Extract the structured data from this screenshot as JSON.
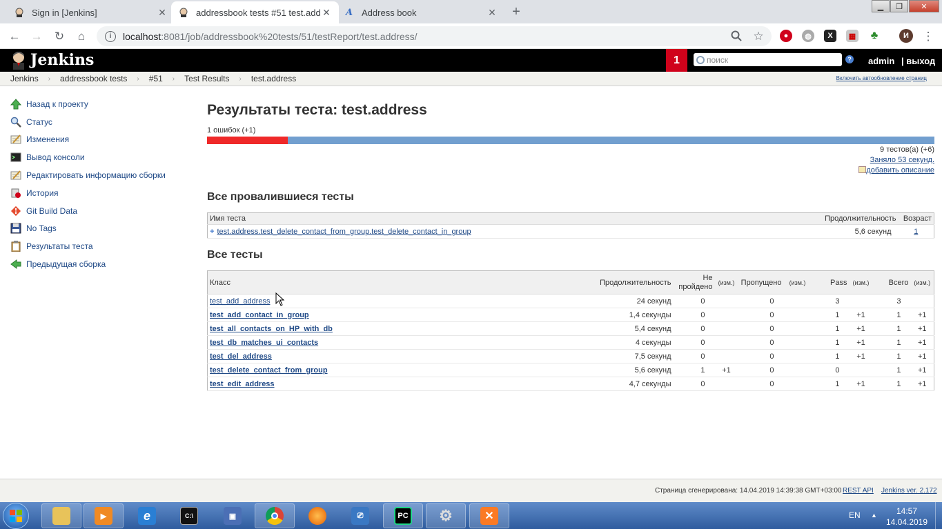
{
  "browser": {
    "tabs": [
      {
        "title": "Sign in [Jenkins]",
        "active": false
      },
      {
        "title": "addressbook tests #51 test.address",
        "active": true
      },
      {
        "title": "Address book",
        "active": false
      }
    ],
    "url_host": "localhost",
    "url_path": ":8081/job/addressbook%20tests/51/testReport/test.address/"
  },
  "header": {
    "logo_text": "Jenkins",
    "notification_count": "1",
    "search_placeholder": "поиск",
    "help": "?",
    "user": "admin",
    "logout": "| выход"
  },
  "breadcrumbs": [
    "Jenkins",
    "addressbook tests",
    "#51",
    "Test Results",
    "test.address"
  ],
  "auto_refresh": "Включить автообновление страниц",
  "sidebar": {
    "items": [
      {
        "label": "Назад к проекту",
        "icon": "up-arrow-icon"
      },
      {
        "label": "Статус",
        "icon": "magnifier-icon"
      },
      {
        "label": "Изменения",
        "icon": "notepad-icon"
      },
      {
        "label": "Вывод консоли",
        "icon": "terminal-icon"
      },
      {
        "label": "Редактировать информацию сборки",
        "icon": "notepad-icon"
      },
      {
        "label": "История",
        "icon": "history-icon"
      },
      {
        "label": "Git Build Data",
        "icon": "git-icon"
      },
      {
        "label": "No Tags",
        "icon": "floppy-icon"
      },
      {
        "label": "Результаты теста",
        "icon": "clipboard-icon"
      },
      {
        "label": "Предыдущая сборка",
        "icon": "left-arrow-icon"
      }
    ]
  },
  "main": {
    "title": "Результаты теста: test.address",
    "fail_summary": "1 ошибок (+1)",
    "fail_ratio": 0.111,
    "tests_count": "9 тестов(а) (+6)",
    "duration": "Заняло 53 секунд.",
    "add_description": "добавить описание",
    "failed_section": {
      "title": "Все провалившиеся тесты",
      "headers": [
        "Имя теста",
        "Продолжительность",
        "Возраст"
      ],
      "rows": [
        {
          "name": "test.address.test_delete_contact_from_group.test_delete_contact_in_group",
          "duration": "5,6 секунд",
          "age": "1"
        }
      ]
    },
    "all_section": {
      "title": "Все тесты",
      "headers": {
        "class": "Класс",
        "duration": "Продолжительность",
        "failed_1": "Не",
        "failed_2": "пройдено",
        "diff": "(изм.)",
        "skipped": "Пропущено",
        "pass": "Pass",
        "total": "Всего"
      },
      "rows": [
        {
          "name": "test_add_address",
          "bold": false,
          "duration": "24 секунд",
          "fail": "0",
          "fail_diff": "",
          "skip": "0",
          "skip_diff": "",
          "pass": "3",
          "pass_diff": "",
          "total": "3",
          "total_diff": ""
        },
        {
          "name": "test_add_contact_in_group",
          "bold": true,
          "duration": "1,4 секунды",
          "fail": "0",
          "fail_diff": "",
          "skip": "0",
          "skip_diff": "",
          "pass": "1",
          "pass_diff": "+1",
          "total": "1",
          "total_diff": "+1"
        },
        {
          "name": "test_all_contacts_on_HP_with_db",
          "bold": true,
          "duration": "5,4 секунд",
          "fail": "0",
          "fail_diff": "",
          "skip": "0",
          "skip_diff": "",
          "pass": "1",
          "pass_diff": "+1",
          "total": "1",
          "total_diff": "+1"
        },
        {
          "name": "test_db_matches_ui_contacts",
          "bold": true,
          "duration": "4 секунды",
          "fail": "0",
          "fail_diff": "",
          "skip": "0",
          "skip_diff": "",
          "pass": "1",
          "pass_diff": "+1",
          "total": "1",
          "total_diff": "+1"
        },
        {
          "name": "test_del_address",
          "bold": true,
          "duration": "7,5 секунд",
          "fail": "0",
          "fail_diff": "",
          "skip": "0",
          "skip_diff": "",
          "pass": "1",
          "pass_diff": "+1",
          "total": "1",
          "total_diff": "+1"
        },
        {
          "name": "test_delete_contact_from_group",
          "bold": true,
          "duration": "5,6 секунд",
          "fail": "1",
          "fail_diff": "+1",
          "skip": "0",
          "skip_diff": "",
          "pass": "0",
          "pass_diff": "",
          "total": "1",
          "total_diff": "+1"
        },
        {
          "name": "test_edit_address",
          "bold": true,
          "duration": "4,7 секунды",
          "fail": "0",
          "fail_diff": "",
          "skip": "0",
          "skip_diff": "",
          "pass": "1",
          "pass_diff": "+1",
          "total": "1",
          "total_diff": "+1"
        }
      ]
    }
  },
  "footer": {
    "generated": "Страница сгенерирована: 14.04.2019 14:39:38 GMT+03:00",
    "rest_api": "REST API",
    "version": "Jenkins ver. 2.172"
  },
  "taskbar": {
    "lang": "EN",
    "time": "14:57",
    "date": "14.04.2019"
  },
  "colors": {
    "fail": "#ef2929",
    "pass": "#729fcf",
    "header": "#000000",
    "badge": "#d0021b"
  }
}
